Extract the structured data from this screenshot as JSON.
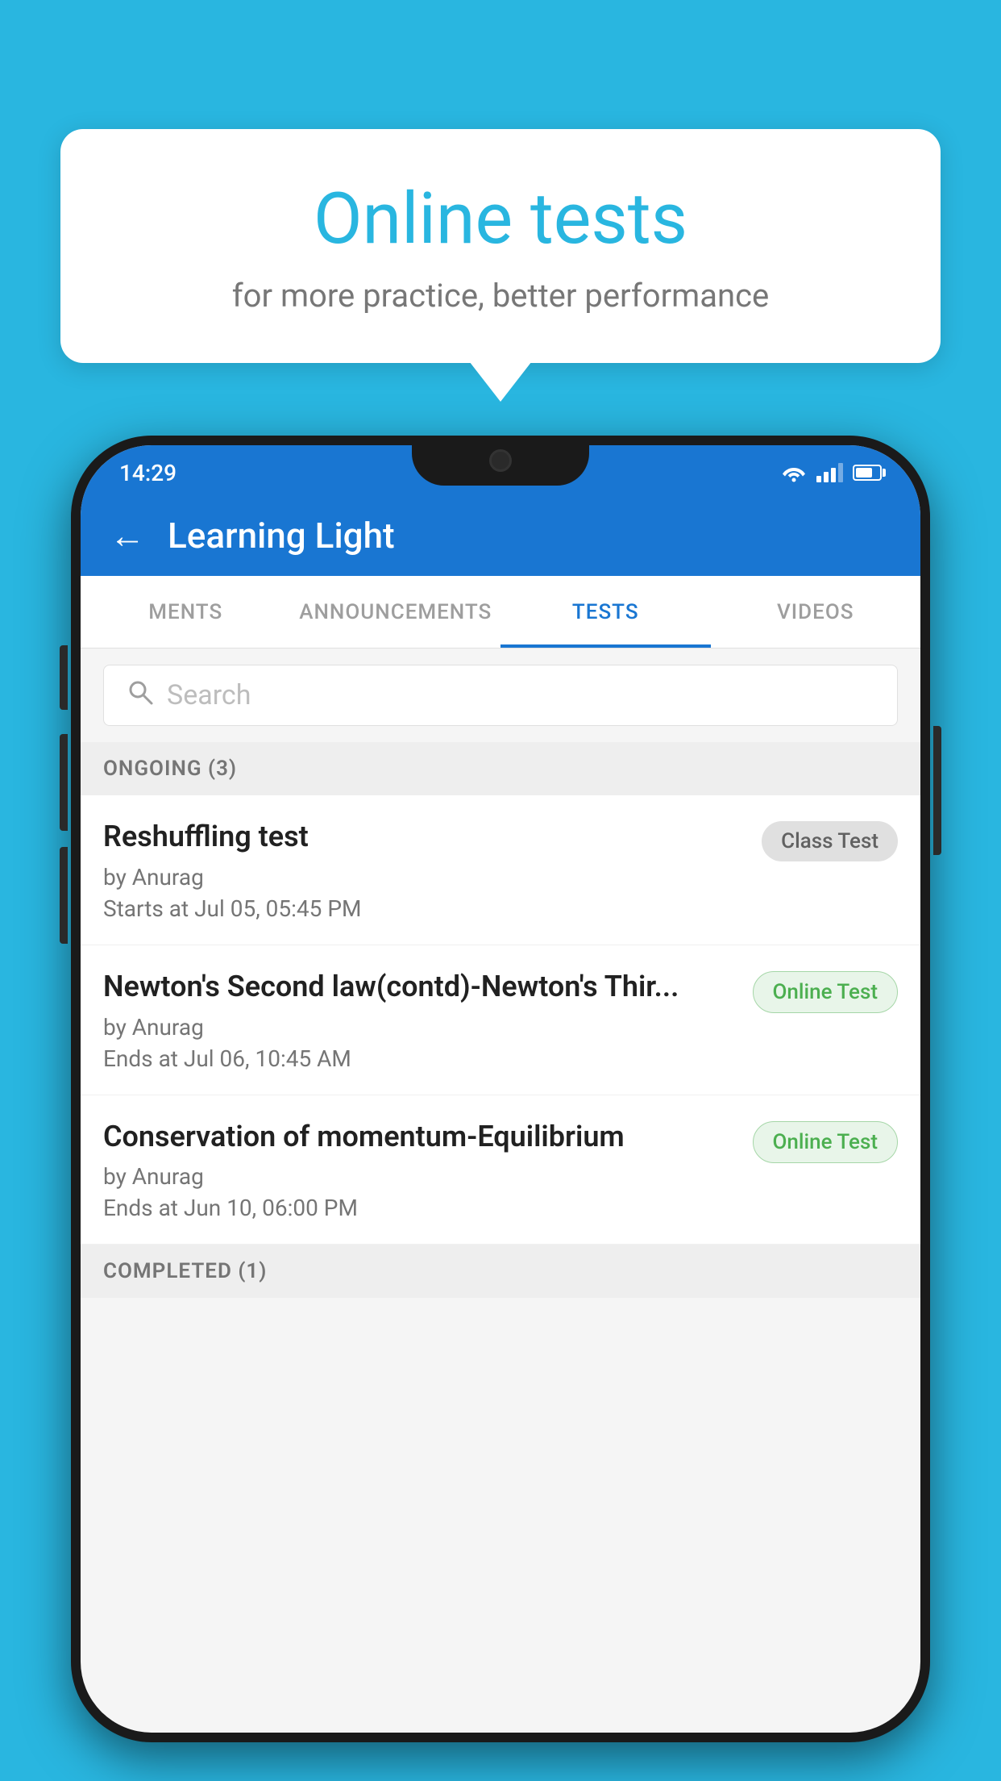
{
  "background_color": "#29b6e0",
  "speech_bubble": {
    "title": "Online tests",
    "subtitle": "for more practice, better performance"
  },
  "phone": {
    "status_bar": {
      "time": "14:29",
      "wifi": "▼",
      "signal": "▲",
      "battery": "70"
    },
    "header": {
      "title": "Learning Light",
      "back_label": "←"
    },
    "tabs": [
      {
        "label": "MENTS",
        "active": false
      },
      {
        "label": "ANNOUNCEMENTS",
        "active": false
      },
      {
        "label": "TESTS",
        "active": true
      },
      {
        "label": "VIDEOS",
        "active": false
      }
    ],
    "search": {
      "placeholder": "Search"
    },
    "sections": [
      {
        "label": "ONGOING (3)",
        "tests": [
          {
            "name": "Reshuffling test",
            "author": "by Anurag",
            "date": "Starts at  Jul 05, 05:45 PM",
            "badge": "Class Test",
            "badge_type": "class"
          },
          {
            "name": "Newton's Second law(contd)-Newton's Thir...",
            "author": "by Anurag",
            "date": "Ends at  Jul 06, 10:45 AM",
            "badge": "Online Test",
            "badge_type": "online"
          },
          {
            "name": "Conservation of momentum-Equilibrium",
            "author": "by Anurag",
            "date": "Ends at  Jun 10, 06:00 PM",
            "badge": "Online Test",
            "badge_type": "online"
          }
        ]
      }
    ],
    "completed_section": {
      "label": "COMPLETED (1)"
    }
  }
}
